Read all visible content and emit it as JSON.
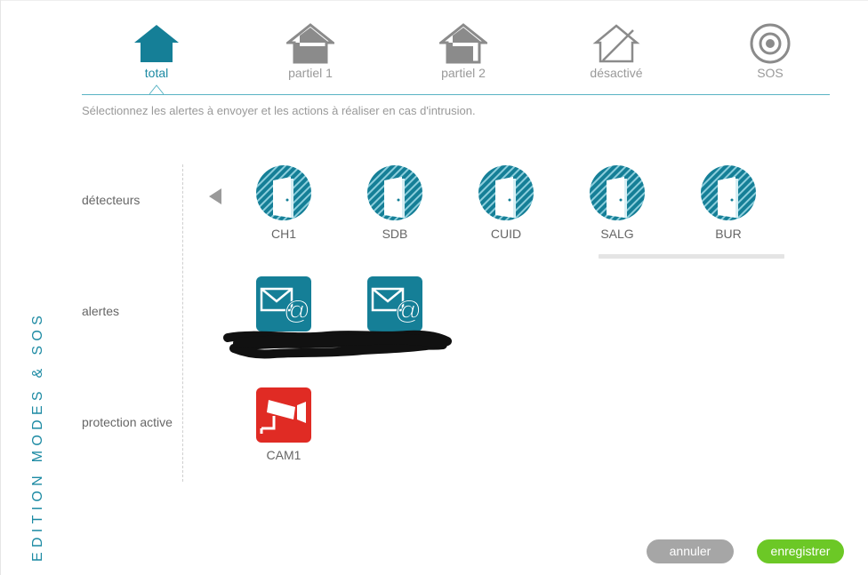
{
  "panel_title": "EDITION MODES & SOS",
  "modes": [
    {
      "label": "total",
      "icon": "house-filled-icon",
      "active": true
    },
    {
      "label": "partiel 1",
      "icon": "house-partial-icon",
      "active": false
    },
    {
      "label": "partiel 2",
      "icon": "house-partial-icon",
      "active": false
    },
    {
      "label": "désactivé",
      "icon": "house-outline-slashed-icon",
      "active": false
    },
    {
      "label": "SOS",
      "icon": "target-icon",
      "active": false
    }
  ],
  "instructions": "Sélectionnez les alertes à envoyer et les actions à réaliser en cas d'intrusion.",
  "rows": {
    "detectors": "détecteurs",
    "alerts": "alertes",
    "protection": "protection active"
  },
  "detectors": [
    {
      "label": "CH1",
      "icon": "door-sensor-icon"
    },
    {
      "label": "SDB",
      "icon": "door-sensor-icon"
    },
    {
      "label": "CUID",
      "icon": "door-sensor-icon"
    },
    {
      "label": "SALG",
      "icon": "door-sensor-icon"
    },
    {
      "label": "BUR",
      "icon": "door-sensor-icon"
    }
  ],
  "alerts": [
    {
      "icon": "email-alert-icon"
    },
    {
      "icon": "email-alert-icon"
    }
  ],
  "protections": [
    {
      "label": "CAM1",
      "icon": "camera-icon"
    }
  ],
  "buttons": {
    "cancel": "annuler",
    "save": "enregistrer"
  },
  "colors": {
    "accent": "#1c8aa3",
    "icon_teal": "#157f97",
    "camera_red": "#e02b24",
    "save_green": "#6cc826",
    "cancel_grey": "#a6a6a6"
  }
}
